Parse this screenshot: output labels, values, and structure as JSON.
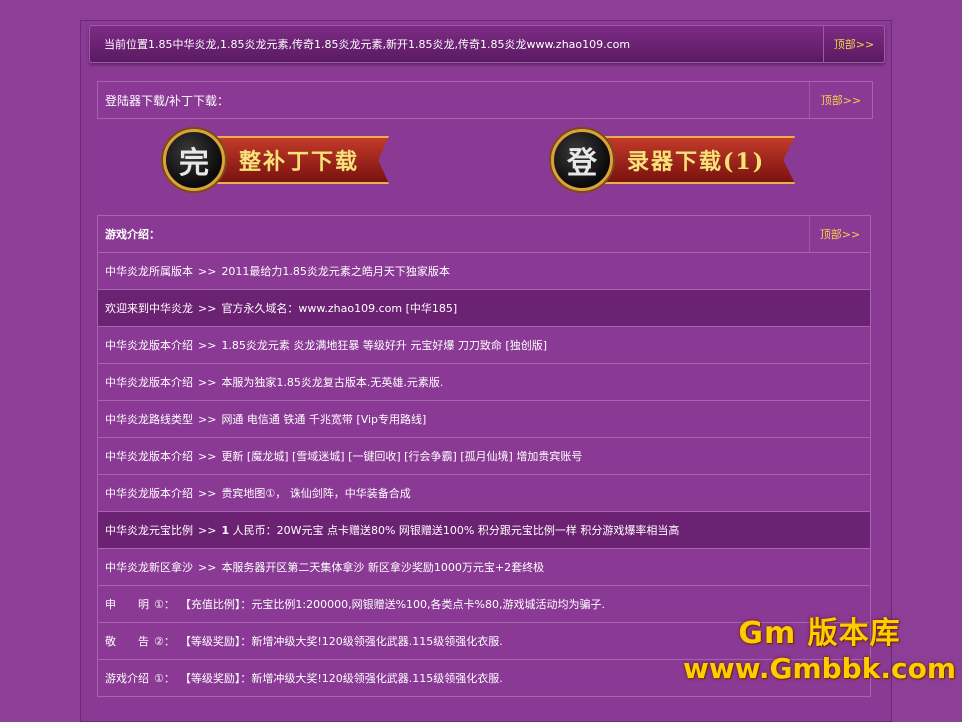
{
  "breadcrumb": "当前位置1.85中华炎龙,1.85炎龙元素,传奇1.85炎龙元素,新开1.85炎龙,传奇1.85炎龙www.zhao109.com",
  "top_link": "顶部>>",
  "download_panel": {
    "title": "登陆器下载/补丁下载：",
    "top_link": "顶部>>",
    "buttons": [
      {
        "disc": "完",
        "label": "整补丁下载"
      },
      {
        "disc": "登",
        "label": "录器下载(1)"
      }
    ]
  },
  "intro": {
    "title": "游戏介绍：",
    "top_link": "顶部>>",
    "rows": [
      {
        "key": "中华炎龙所属版本",
        "sep": ">>",
        "value": "2011最给力1.85炎龙元素之皓月天下独家版本"
      },
      {
        "key": "欢迎来到中华炎龙",
        "sep": ">>",
        "value": "官方永久域名：www.zhao109.com [中华185]"
      },
      {
        "key": "中华炎龙版本介绍",
        "sep": ">>",
        "value": "1.85炎龙元素 炎龙满地狂暴 等级好升 元宝好爆 刀刀致命 [独创版]"
      },
      {
        "key": "中华炎龙版本介绍",
        "sep": ">>",
        "value": "本服为独家1.85炎龙复古版本.无英雄.元素版."
      },
      {
        "key": "中华炎龙路线类型",
        "sep": ">>",
        "value": "网通 电信通 铁通 千兆宽带 [Vip专用路线]"
      },
      {
        "key": "中华炎龙版本介绍",
        "sep": ">>",
        "value": "更新 [魔龙城] [雪域迷城] [一键回收] [行会争霸] [孤月仙境] 增加贵宾账号"
      },
      {
        "key": "中华炎龙版本介绍",
        "sep": ">>",
        "value": "贵宾地图①， 诛仙剑阵，中华装备合成"
      },
      {
        "key": "中华炎龙元宝比例",
        "sep": ">>",
        "value_bold": "1",
        "value": "人民币：20W元宝 点卡赠送80% 网银赠送100% 积分跟元宝比例一样 积分游戏爆率相当高"
      },
      {
        "key": "中华炎龙新区拿沙",
        "sep": ">>",
        "value": "本服务器开区第二天集体拿沙 新区拿沙奖励1000万元宝+2套终极"
      },
      {
        "key": "申　　明",
        "sep": "①：",
        "value": "【充值比例】：元宝比例1:200000,网银赠送%100,各类点卡%80,游戏城活动均为骗子."
      },
      {
        "key": "敬　　告",
        "sep": "②：",
        "value": "【等级奖励】：新增冲级大奖!120级领强化武器.115级领强化衣服."
      },
      {
        "key": "游戏介绍",
        "sep": "①：",
        "value": "【等级奖励】：新增冲级大奖!120级领强化武器.115级领强化衣服."
      }
    ]
  },
  "watermark": {
    "line1": "Gm 版本库",
    "line2": "www.Gmbbk.com"
  }
}
